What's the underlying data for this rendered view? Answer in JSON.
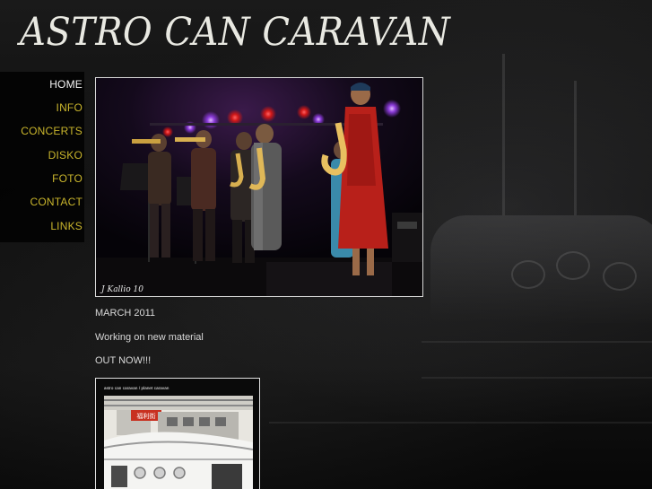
{
  "header": {
    "site_title": "ASTRO CAN CARAVAN"
  },
  "nav": {
    "items": [
      {
        "label": "HOME",
        "active": true
      },
      {
        "label": "INFO",
        "active": false
      },
      {
        "label": "CONCERTS",
        "active": false
      },
      {
        "label": "DISKO",
        "active": false
      },
      {
        "label": "FOTO",
        "active": false
      },
      {
        "label": "CONTACT",
        "active": false
      },
      {
        "label": "LINKS",
        "active": false
      }
    ]
  },
  "main": {
    "photo_credit": "J Kallio 10",
    "news_date": "MARCH 2011",
    "news_text": "Working on new material",
    "release_text": "OUT NOW!!!",
    "album_caption": "astro can caravan / planet caravan",
    "album_sign": "福利街"
  },
  "colors": {
    "nav_link": "#c9b52c",
    "nav_active": "#f2f2f2",
    "body_text": "#d8d8d8",
    "title": "#e9e9e2"
  }
}
